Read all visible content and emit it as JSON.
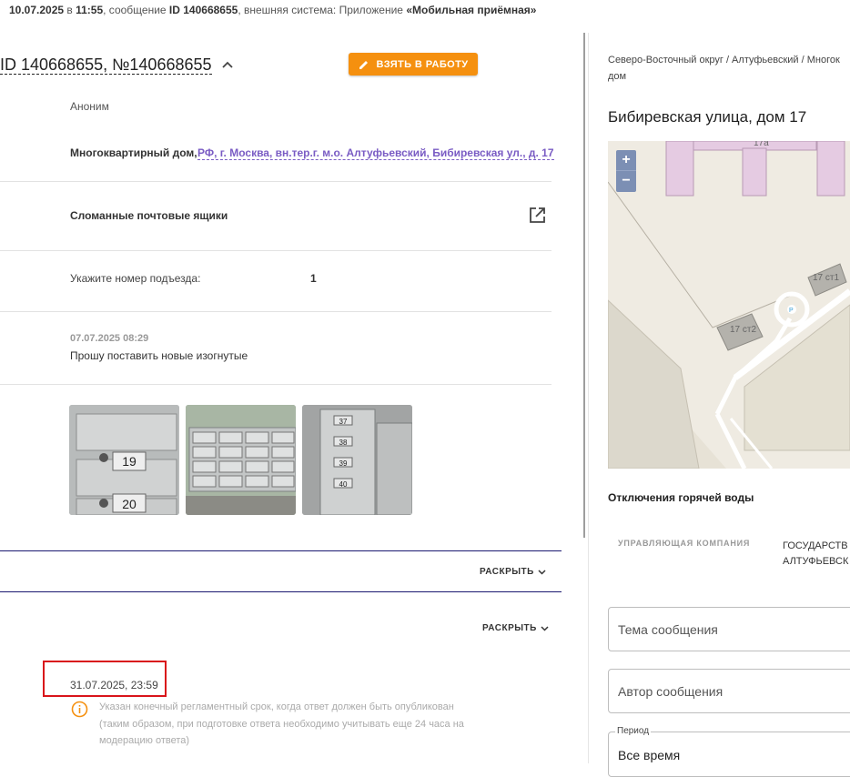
{
  "topbar": {
    "datetime": "10.07.2025",
    "at": " в ",
    "time": "11:55",
    "msg_prefix": ", сообщение ",
    "msg_id": "ID 140668655",
    "system_prefix": ", внешняя система: Приложение ",
    "system": "«Мобильная приёмная»"
  },
  "ticket": {
    "title": "ID 140668655, №140668655",
    "take_button": "ВЗЯТЬ В РАБОТУ",
    "author": "Аноним",
    "object_type": "Многоквартирный дом,",
    "address": "РФ, г. Москва, вн.тер.г. м.о. Алтуфьевский, Бибиревская ул., д. 17",
    "problem": "Сломанные почтовые ящики",
    "entrance_label": "Укажите номер подъезда:",
    "entrance_value": "1",
    "comment_date": "07.07.2025 08:29",
    "comment_text": "Прошу поставить новые изогнутые",
    "expand1": "РАСКРЫТЬ",
    "expand2": "РАСКРЫТЬ",
    "deadline": "31.07.2025, 23:59",
    "deadline_note_1": "Указан конечный регламентный срок, когда ответ должен быть опубликован",
    "deadline_note_2": "(таким образом, при подготовке ответа необходимо учитывать еще 24 часа на",
    "deadline_note_3": "модерацию ответа)",
    "photos": [
      {
        "numbers": [
          "19",
          "20"
        ]
      },
      {
        "numbers": []
      },
      {
        "numbers": [
          "37",
          "38",
          "39",
          "40"
        ]
      }
    ]
  },
  "side": {
    "breadcrumb_1": "Северо-Восточный округ / Алтуфьевский / Многок",
    "breadcrumb_2": "дом",
    "address_title": "Бибиревская улица, дом 17",
    "map": {
      "zoom_in": "+",
      "zoom_out": "−",
      "building_17a": "17а",
      "building_17st1": "17 ст1",
      "building_17st2": "17 ст2",
      "parking": "P"
    },
    "hot_water": "Отключения горячей воды",
    "mgmt_label": "УПРАВЛЯЮЩАЯ КОМПАНИЯ",
    "mgmt_value_1": "ГОСУДАРСТВ",
    "mgmt_value_2": "АЛТУФЬЕВСК",
    "topic_placeholder": "Тема сообщения",
    "author_placeholder": "Автор сообщения",
    "period_label": "Период",
    "period_value": "Все время"
  },
  "colors": {
    "accent_orange": "#f5900f",
    "link_purple": "#7a5cc4",
    "divider_navy": "#1a1870",
    "highlight_red": "#d9141a"
  }
}
